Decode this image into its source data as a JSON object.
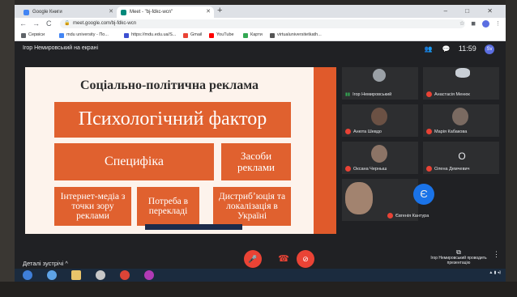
{
  "browser": {
    "tabs": [
      {
        "label": "Google Книги",
        "favicon_color": "#4285f4"
      },
      {
        "label": "Meet - \"bj-fdkc-wcn\"",
        "favicon_color": "#00897b"
      }
    ],
    "new_tab": "+",
    "window_controls": "– □ ✕",
    "nav": {
      "back": "←",
      "forward": "→",
      "reload": "C"
    },
    "url": "meet.google.com/bj-fdkc-wcn",
    "bookmarks": [
      {
        "label": "Сервіси",
        "color": "#5f6368"
      },
      {
        "label": "mdu university - По...",
        "color": "#4285f4"
      },
      {
        "label": "https://mdu.edu.ua/S...",
        "color": "#3c4fd1"
      },
      {
        "label": "Gmail",
        "color": "#ea4335"
      },
      {
        "label": "YouTube",
        "color": "#ff0000"
      },
      {
        "label": "Карти",
        "color": "#34a853"
      },
      {
        "label": "virtualuniversitetkath...",
        "color": "#555555"
      }
    ]
  },
  "meet": {
    "presenter_label": "Ігор Немировський на екрані",
    "clock": "11:59",
    "top_icons": [
      "people-icon",
      "chat-icon"
    ],
    "my_initials": "Sv",
    "slide": {
      "title": "Соціально-політична реклама",
      "boxes": {
        "psych": "Психологічний фактор",
        "spec": "Специфіка",
        "means": "Засоби реклами",
        "internet": "Інтернет-медіа з точки зору реклами",
        "need": "Потреба в перекладі",
        "distr": "Дистрибʼюція та локалізація в Україні"
      }
    },
    "participants": [
      {
        "name": "Ігор Немировський",
        "muted": false,
        "initial": ""
      },
      {
        "name": "Анастасія Менюк",
        "muted": true,
        "initial": ""
      },
      {
        "name": "Анюта Шевдо",
        "muted": true,
        "initial": ""
      },
      {
        "name": "Марія Кабакова",
        "muted": true,
        "initial": ""
      },
      {
        "name": "Оксана Черныш",
        "muted": true,
        "initial": ""
      },
      {
        "name": "Олена Демчевич",
        "muted": true,
        "initial": "О"
      },
      {
        "name": "",
        "muted": false,
        "initial": ""
      },
      {
        "name": "Євгенія Кантура",
        "muted": true,
        "initial": "Є"
      }
    ],
    "details_label": "Деталі зустрічі",
    "details_chevron": "^",
    "present_label": "Ігор Немировський проводить презентацію",
    "colors": {
      "accent_red": "#ea4335",
      "slide_orange": "#e0612f",
      "meet_bg": "#202124"
    }
  }
}
